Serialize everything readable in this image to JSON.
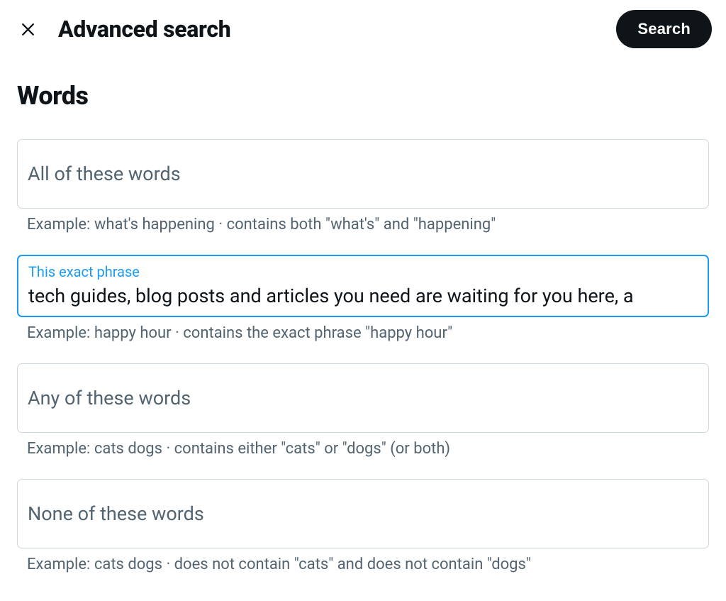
{
  "header": {
    "title": "Advanced search",
    "search_button": "Search"
  },
  "section": {
    "title": "Words"
  },
  "fields": {
    "all_words": {
      "placeholder": "All of these words",
      "value": "",
      "helper": "Example: what's happening · contains both \"what's\" and \"happening\""
    },
    "exact_phrase": {
      "label": "This exact phrase",
      "value": "tech guides, blog posts and articles you need are waiting for you here, a",
      "helper": "Example: happy hour · contains the exact phrase \"happy hour\""
    },
    "any_words": {
      "placeholder": "Any of these words",
      "value": "",
      "helper": "Example: cats dogs · contains either \"cats\" or \"dogs\" (or both)"
    },
    "none_words": {
      "placeholder": "None of these words",
      "value": "",
      "helper": "Example: cats dogs · does not contain \"cats\" and does not contain \"dogs\""
    }
  }
}
